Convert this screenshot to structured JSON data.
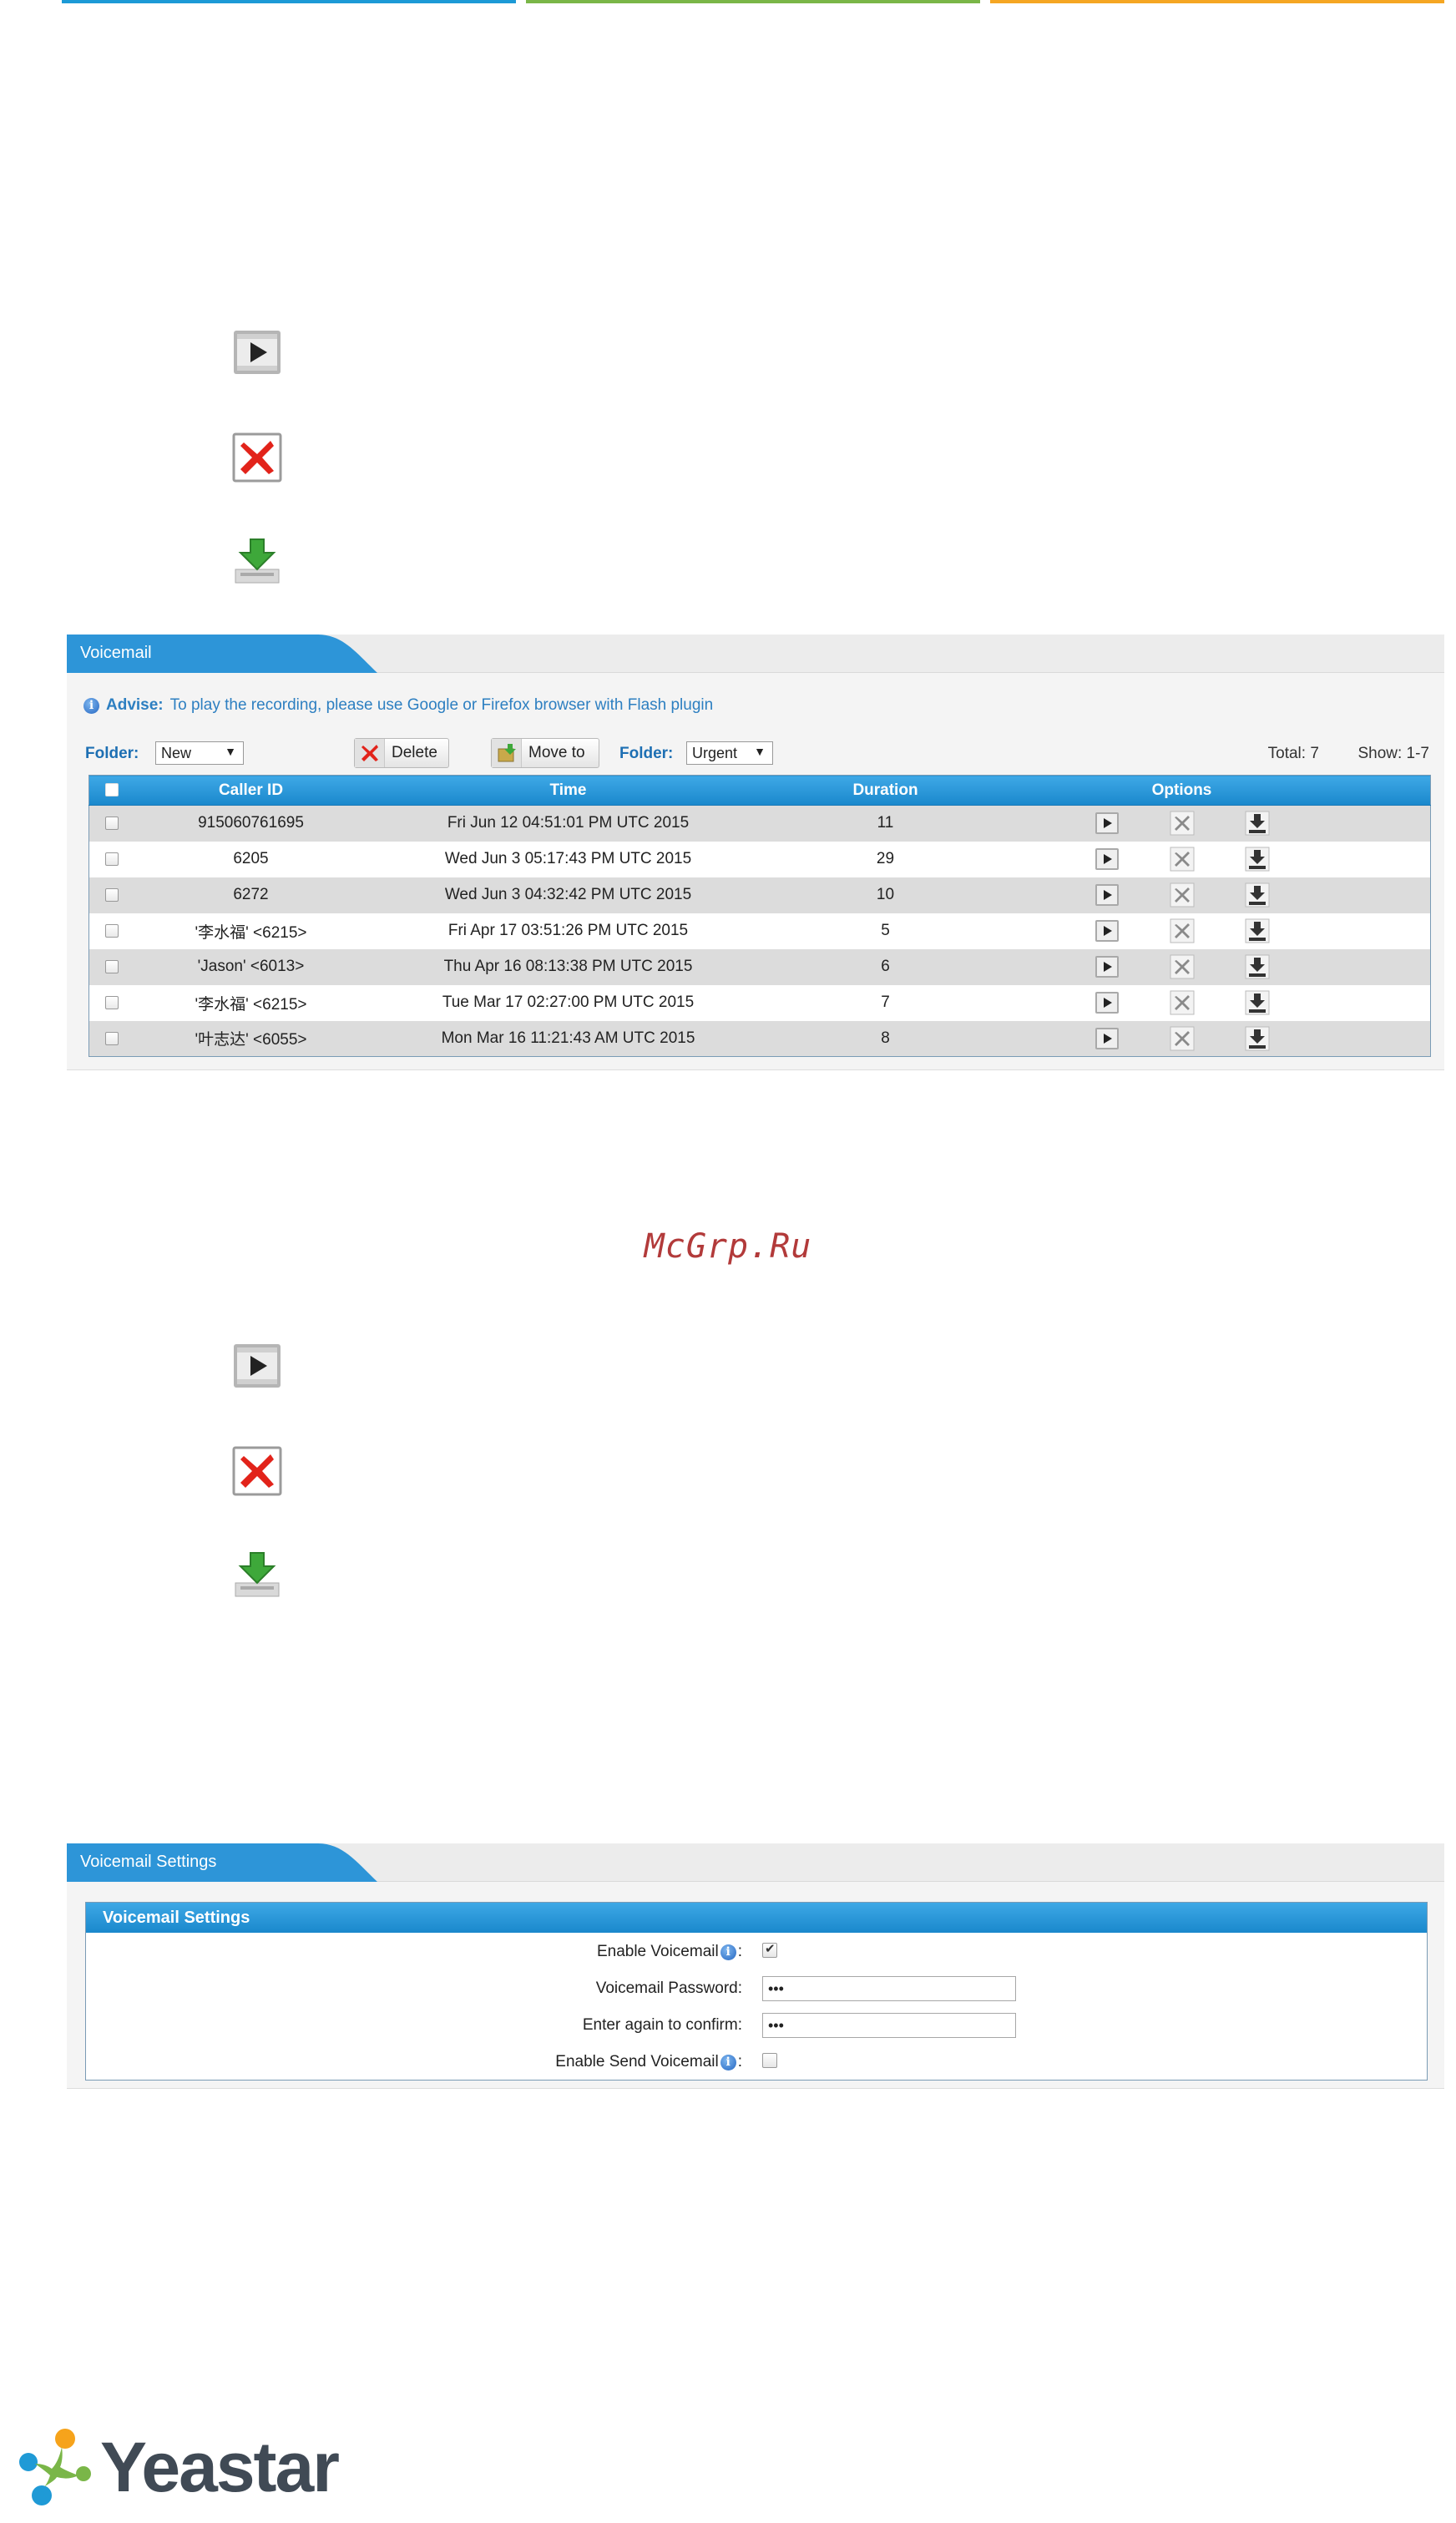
{
  "voicemail_panel": {
    "tab_title": "Voicemail",
    "advise_label": "Advise:",
    "advise_text": "To play the recording, please use Google or Firefox browser with Flash plugin",
    "folder_label": "Folder:",
    "folder_value": "New",
    "delete_label": "Delete",
    "move_label": "Move to",
    "move_folder_label": "Folder:",
    "move_folder_value": "Urgent",
    "total_label": "Total: 7",
    "show_label": "Show: 1-7",
    "columns": {
      "caller_id": "Caller ID",
      "time": "Time",
      "duration": "Duration",
      "options": "Options"
    },
    "rows": [
      {
        "caller_id": "915060761695",
        "time": "Fri Jun 12 04:51:01 PM UTC 2015",
        "duration": "11"
      },
      {
        "caller_id": "6205",
        "time": "Wed Jun 3 05:17:43 PM UTC 2015",
        "duration": "29"
      },
      {
        "caller_id": "6272",
        "time": "Wed Jun 3 04:32:42 PM UTC 2015",
        "duration": "10"
      },
      {
        "caller_id": "'李水福' <6215>",
        "time": "Fri Apr 17 03:51:26 PM UTC 2015",
        "duration": "5"
      },
      {
        "caller_id": "'Jason' <6013>",
        "time": "Thu Apr 16 08:13:38 PM UTC 2015",
        "duration": "6"
      },
      {
        "caller_id": "'李水福' <6215>",
        "time": "Tue Mar 17 02:27:00 PM UTC 2015",
        "duration": "7"
      },
      {
        "caller_id": "'叶志达' <6055>",
        "time": "Mon Mar 16 11:21:43 AM UTC 2015",
        "duration": "8"
      }
    ]
  },
  "watermark": "McGrp.Ru",
  "settings_panel": {
    "tab_title": "Voicemail Settings",
    "box_title": "Voicemail Settings",
    "enable_voicemail_label": "Enable Voicemail",
    "enable_voicemail_checked": true,
    "password_label": "Voicemail Password:",
    "password_value": "•••",
    "confirm_label": "Enter again to confirm:",
    "confirm_value": "•••",
    "enable_send_label": "Enable Send Voicemail",
    "enable_send_checked": false,
    "colon": ":"
  },
  "logo": {
    "text": "Yeastar"
  },
  "icons": {
    "play": "play-icon",
    "delete": "delete-icon",
    "download": "download-icon"
  },
  "colors": {
    "header_blue": "#1a88cc",
    "tab_blue": "#2d95d8",
    "row_gray": "#dcdcdc",
    "link_blue": "#2d7fc1",
    "watermark_red": "#b23a3a"
  }
}
